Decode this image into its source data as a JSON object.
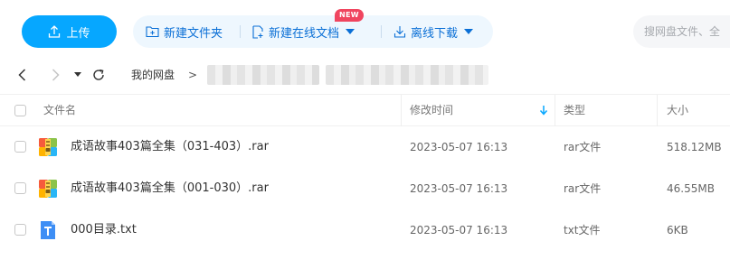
{
  "toolbar": {
    "upload_label": "上传",
    "new_folder_label": "新建文件夹",
    "new_online_doc_label": "新建在线文档",
    "new_badge": "NEW",
    "offline_download_label": "离线下载",
    "search_placeholder": "搜网盘文件、全"
  },
  "breadcrumb": {
    "root": "我的网盘",
    "separator": ">"
  },
  "table": {
    "headers": {
      "name": "文件名",
      "modified": "修改时间",
      "type": "类型",
      "size": "大小"
    },
    "rows": [
      {
        "name": "成语故事403篇全集（031-403）.rar",
        "modified": "2023-05-07 16:13",
        "type": "rar文件",
        "size": "518.12MB",
        "icon": "archive-icon"
      },
      {
        "name": "成语故事403篇全集（001-030）.rar",
        "modified": "2023-05-07 16:13",
        "type": "rar文件",
        "size": "46.55MB",
        "icon": "archive-icon"
      },
      {
        "name": "000目录.txt",
        "modified": "2023-05-07 16:13",
        "type": "txt文件",
        "size": "6KB",
        "icon": "text-file-icon"
      }
    ]
  },
  "colors": {
    "accent": "#06a7ff",
    "action_text": "#0a6fd6",
    "action_bg": "#eef7fe",
    "badge": "#f0455f"
  }
}
